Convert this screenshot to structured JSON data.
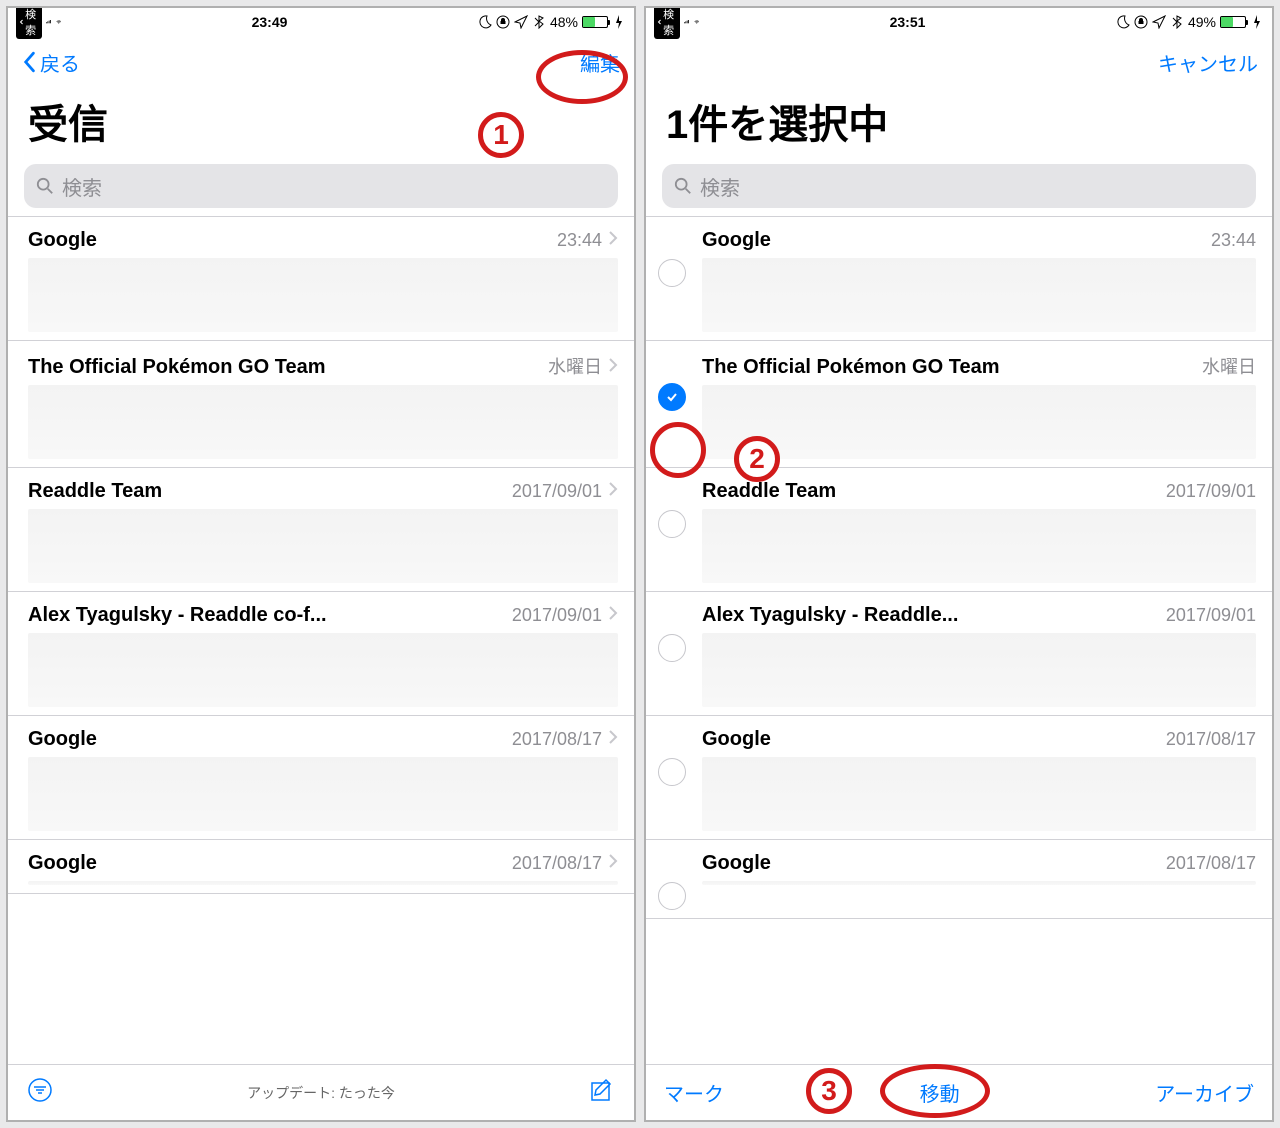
{
  "left": {
    "status": {
      "carrier": "検索",
      "time": "23:49",
      "battery_pct": "48%",
      "battery_fill": 48
    },
    "nav": {
      "back": "戻る",
      "edit": "編集"
    },
    "title": "受信",
    "search_ph": "検索",
    "rows": [
      {
        "sender": "Google",
        "date": "23:44"
      },
      {
        "sender": "The Official Pokémon GO Team",
        "date": "水曜日"
      },
      {
        "sender": "Readdle Team",
        "date": "2017/09/01"
      },
      {
        "sender": "Alex Tyagulsky - Readdle co-f...",
        "date": "2017/09/01"
      },
      {
        "sender": "Google",
        "date": "2017/08/17"
      },
      {
        "sender": "Google",
        "date": "2017/08/17"
      }
    ],
    "footer": "アップデート: たった今"
  },
  "right": {
    "status": {
      "carrier": "検索",
      "time": "23:51",
      "battery_pct": "49%",
      "battery_fill": 49
    },
    "nav": {
      "cancel": "キャンセル"
    },
    "title": "1件を選択中",
    "search_ph": "検索",
    "rows": [
      {
        "sender": "Google",
        "date": "23:44",
        "checked": false
      },
      {
        "sender": "The Official Pokémon GO Team",
        "date": "水曜日",
        "checked": true
      },
      {
        "sender": "Readdle Team",
        "date": "2017/09/01",
        "checked": false
      },
      {
        "sender": "Alex Tyagulsky - Readdle...",
        "date": "2017/09/01",
        "checked": false
      },
      {
        "sender": "Google",
        "date": "2017/08/17",
        "checked": false
      },
      {
        "sender": "Google",
        "date": "2017/08/17",
        "checked": false
      }
    ],
    "toolbar": {
      "mark": "マーク",
      "move": "移動",
      "archive": "アーカイブ"
    }
  },
  "annotations": {
    "n1": "1",
    "n2": "2",
    "n3": "3"
  }
}
